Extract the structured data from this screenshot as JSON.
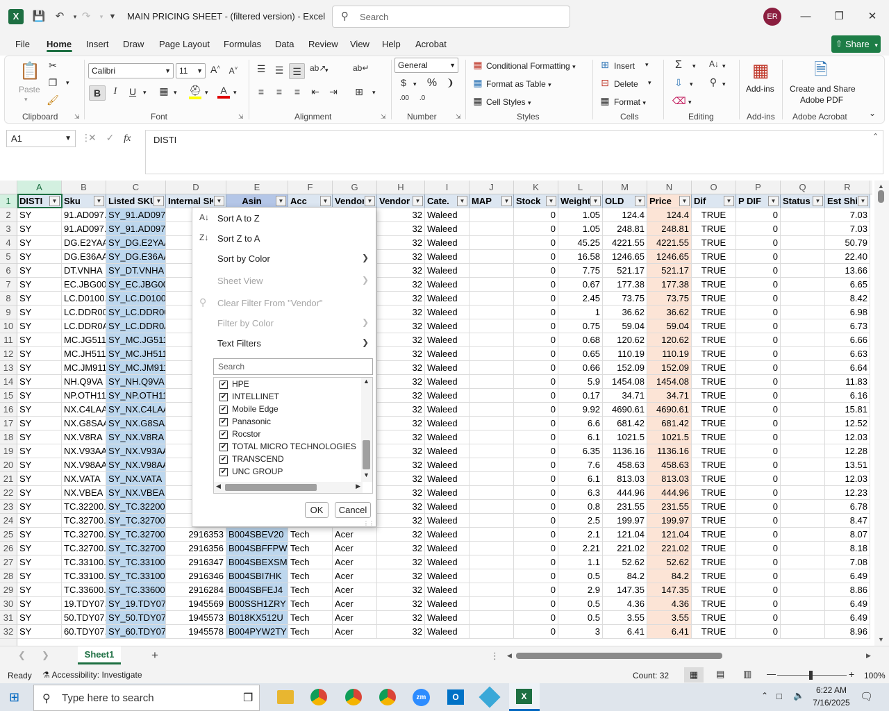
{
  "titlebar": {
    "title": "MAIN PRICING SHEET - (filtered version)  -  Excel",
    "search_placeholder": "Search",
    "user_initials": "ER"
  },
  "menu": [
    "File",
    "Home",
    "Insert",
    "Draw",
    "Page Layout",
    "Formulas",
    "Data",
    "Review",
    "View",
    "Help",
    "Acrobat"
  ],
  "share_label": "Share",
  "ribbon": {
    "paste": "Paste",
    "font_name": "Calibri",
    "font_size": "11",
    "number_format": "General",
    "conditional_formatting": "Conditional Formatting",
    "format_as_table": "Format as Table",
    "cell_styles": "Cell Styles",
    "insert": "Insert",
    "delete": "Delete",
    "format": "Format",
    "addins": "Add-ins",
    "create_share_line1": "Create and Share",
    "create_share_line2": "Adobe PDF",
    "groups": {
      "clipboard": "Clipboard",
      "font": "Font",
      "alignment": "Alignment",
      "number": "Number",
      "styles": "Styles",
      "cells": "Cells",
      "editing": "Editing",
      "addins": "Add-ins",
      "adobe": "Adobe Acrobat"
    }
  },
  "formula_bar": {
    "name_box": "A1",
    "content": "DISTI"
  },
  "columns": [
    "A",
    "B",
    "C",
    "D",
    "E",
    "F",
    "G",
    "H",
    "I",
    "J",
    "K",
    "L",
    "M",
    "N",
    "O",
    "P",
    "Q",
    "R"
  ],
  "headers": [
    "DISTI",
    "Sku",
    "Listed SKU",
    "Internal SK",
    "Asin",
    "Acc",
    "Vendor",
    "Vendor",
    "Cate.",
    "MAP",
    "Stock",
    "Weight",
    "OLD",
    "Price",
    "Dif",
    "P DIF",
    "Status",
    "Est Ship"
  ],
  "rows": [
    {
      "n": "2",
      "a": "SY",
      "b": "91.AD097.",
      "c": "SY_91.AD097.",
      "d": "",
      "e": "",
      "f": "",
      "g": "",
      "h": "32",
      "i": "Waleed",
      "j": "",
      "k": "0",
      "l": "1.05",
      "m": "124.4",
      "np": "124.4",
      "o": "TRUE",
      "p": "0",
      "q": "",
      "r": "7.03"
    },
    {
      "n": "3",
      "a": "SY",
      "b": "91.AD097.",
      "c": "SY_91.AD097.",
      "d": "",
      "e": "",
      "f": "",
      "g": "",
      "h": "32",
      "i": "Waleed",
      "j": "",
      "k": "0",
      "l": "1.05",
      "m": "248.81",
      "np": "248.81",
      "o": "TRUE",
      "p": "0",
      "q": "",
      "r": "7.03"
    },
    {
      "n": "4",
      "a": "SY",
      "b": "DG.E2YAA",
      "c": "SY_DG.E2YAA",
      "d": "",
      "e": "",
      "f": "",
      "g": "",
      "h": "32",
      "i": "Waleed",
      "j": "",
      "k": "0",
      "l": "45.25",
      "m": "4221.55",
      "np": "4221.55",
      "o": "TRUE",
      "p": "0",
      "q": "",
      "r": "50.79"
    },
    {
      "n": "5",
      "a": "SY",
      "b": "DG.E36AA",
      "c": "SY_DG.E36AA",
      "d": "",
      "e": "",
      "f": "",
      "g": "",
      "h": "32",
      "i": "Waleed",
      "j": "",
      "k": "0",
      "l": "16.58",
      "m": "1246.65",
      "np": "1246.65",
      "o": "TRUE",
      "p": "0",
      "q": "",
      "r": "22.40"
    },
    {
      "n": "6",
      "a": "SY",
      "b": "DT.VNHA",
      "c": "SY_DT.VNHA",
      "d": "",
      "e": "",
      "f": "",
      "g": "",
      "h": "32",
      "i": "Waleed",
      "j": "",
      "k": "0",
      "l": "7.75",
      "m": "521.17",
      "np": "521.17",
      "o": "TRUE",
      "p": "0",
      "q": "",
      "r": "13.66"
    },
    {
      "n": "7",
      "a": "SY",
      "b": "EC.JBG00.",
      "c": "SY_EC.JBG00.",
      "d": "",
      "e": "",
      "f": "",
      "g": "",
      "h": "32",
      "i": "Waleed",
      "j": "",
      "k": "0",
      "l": "0.67",
      "m": "177.38",
      "np": "177.38",
      "o": "TRUE",
      "p": "0",
      "q": "",
      "r": "6.65"
    },
    {
      "n": "8",
      "a": "SY",
      "b": "LC.D0100.",
      "c": "SY_LC.D0100.",
      "d": "",
      "e": "",
      "f": "",
      "g": "",
      "h": "32",
      "i": "Waleed",
      "j": "",
      "k": "0",
      "l": "2.45",
      "m": "73.75",
      "np": "73.75",
      "o": "TRUE",
      "p": "0",
      "q": "",
      "r": "8.42"
    },
    {
      "n": "9",
      "a": "SY",
      "b": "LC.DDR00.",
      "c": "SY_LC.DDR00.",
      "d": "",
      "e": "",
      "f": "",
      "g": "",
      "h": "32",
      "i": "Waleed",
      "j": "",
      "k": "0",
      "l": "1",
      "m": "36.62",
      "np": "36.62",
      "o": "TRUE",
      "p": "0",
      "q": "",
      "r": "6.98"
    },
    {
      "n": "10",
      "a": "SY",
      "b": "LC.DDR0A",
      "c": "SY_LC.DDR0A",
      "d": "",
      "e": "",
      "f": "",
      "g": "",
      "h": "32",
      "i": "Waleed",
      "j": "",
      "k": "0",
      "l": "0.75",
      "m": "59.04",
      "np": "59.04",
      "o": "TRUE",
      "p": "0",
      "q": "",
      "r": "6.73"
    },
    {
      "n": "11",
      "a": "SY",
      "b": "MC.JG511",
      "c": "SY_MC.JG511",
      "d": "",
      "e": "",
      "f": "",
      "g": "",
      "h": "32",
      "i": "Waleed",
      "j": "",
      "k": "0",
      "l": "0.68",
      "m": "120.62",
      "np": "120.62",
      "o": "TRUE",
      "p": "0",
      "q": "",
      "r": "6.66"
    },
    {
      "n": "12",
      "a": "SY",
      "b": "MC.JH511",
      "c": "SY_MC.JH511",
      "d": "",
      "e": "",
      "f": "",
      "g": "",
      "h": "32",
      "i": "Waleed",
      "j": "",
      "k": "0",
      "l": "0.65",
      "m": "110.19",
      "np": "110.19",
      "o": "TRUE",
      "p": "0",
      "q": "",
      "r": "6.63"
    },
    {
      "n": "13",
      "a": "SY",
      "b": "MC.JM911",
      "c": "SY_MC.JM911",
      "d": "",
      "e": "",
      "f": "",
      "g": "",
      "h": "32",
      "i": "Waleed",
      "j": "",
      "k": "0",
      "l": "0.66",
      "m": "152.09",
      "np": "152.09",
      "o": "TRUE",
      "p": "0",
      "q": "",
      "r": "6.64"
    },
    {
      "n": "14",
      "a": "SY",
      "b": "NH.Q9VA",
      "c": "SY_NH.Q9VA",
      "d": "",
      "e": "",
      "f": "",
      "g": "",
      "h": "32",
      "i": "Waleed",
      "j": "",
      "k": "0",
      "l": "5.9",
      "m": "1454.08",
      "np": "1454.08",
      "o": "TRUE",
      "p": "0",
      "q": "",
      "r": "11.83"
    },
    {
      "n": "15",
      "a": "SY",
      "b": "NP.OTH11",
      "c": "SY_NP.OTH11",
      "d": "",
      "e": "",
      "f": "",
      "g": "",
      "h": "32",
      "i": "Waleed",
      "j": "",
      "k": "0",
      "l": "0.17",
      "m": "34.71",
      "np": "34.71",
      "o": "TRUE",
      "p": "0",
      "q": "",
      "r": "6.16"
    },
    {
      "n": "16",
      "a": "SY",
      "b": "NX.C4LAA",
      "c": "SY_NX.C4LAA",
      "d": "",
      "e": "",
      "f": "",
      "g": "",
      "h": "32",
      "i": "Waleed",
      "j": "",
      "k": "0",
      "l": "9.92",
      "m": "4690.61",
      "np": "4690.61",
      "o": "TRUE",
      "p": "0",
      "q": "",
      "r": "15.81"
    },
    {
      "n": "17",
      "a": "SY",
      "b": "NX.G8SAA",
      "c": "SY_NX.G8SAA",
      "d": "",
      "e": "",
      "f": "",
      "g": "",
      "h": "32",
      "i": "Waleed",
      "j": "",
      "k": "0",
      "l": "6.6",
      "m": "681.42",
      "np": "681.42",
      "o": "TRUE",
      "p": "0",
      "q": "",
      "r": "12.52"
    },
    {
      "n": "18",
      "a": "SY",
      "b": "NX.V8RA",
      "c": "SY_NX.V8RA",
      "d": "",
      "e": "",
      "f": "",
      "g": "",
      "h": "32",
      "i": "Waleed",
      "j": "",
      "k": "0",
      "l": "6.1",
      "m": "1021.5",
      "np": "1021.5",
      "o": "TRUE",
      "p": "0",
      "q": "",
      "r": "12.03"
    },
    {
      "n": "19",
      "a": "SY",
      "b": "NX.V93AA",
      "c": "SY_NX.V93AA",
      "d": "",
      "e": "",
      "f": "",
      "g": "",
      "h": "32",
      "i": "Waleed",
      "j": "",
      "k": "0",
      "l": "6.35",
      "m": "1136.16",
      "np": "1136.16",
      "o": "TRUE",
      "p": "0",
      "q": "",
      "r": "12.28"
    },
    {
      "n": "20",
      "a": "SY",
      "b": "NX.V98AA",
      "c": "SY_NX.V98AA",
      "d": "",
      "e": "",
      "f": "",
      "g": "",
      "h": "32",
      "i": "Waleed",
      "j": "",
      "k": "0",
      "l": "7.6",
      "m": "458.63",
      "np": "458.63",
      "o": "TRUE",
      "p": "0",
      "q": "",
      "r": "13.51"
    },
    {
      "n": "21",
      "a": "SY",
      "b": "NX.VATA",
      "c": "SY_NX.VATA",
      "d": "",
      "e": "",
      "f": "",
      "g": "",
      "h": "32",
      "i": "Waleed",
      "j": "",
      "k": "0",
      "l": "6.1",
      "m": "813.03",
      "np": "813.03",
      "o": "TRUE",
      "p": "0",
      "q": "",
      "r": "12.03"
    },
    {
      "n": "22",
      "a": "SY",
      "b": "NX.VBEA",
      "c": "SY_NX.VBEA",
      "d": "",
      "e": "",
      "f": "",
      "g": "",
      "h": "32",
      "i": "Waleed",
      "j": "",
      "k": "0",
      "l": "6.3",
      "m": "444.96",
      "np": "444.96",
      "o": "TRUE",
      "p": "0",
      "q": "",
      "r": "12.23"
    },
    {
      "n": "23",
      "a": "SY",
      "b": "TC.32200.",
      "c": "SY_TC.32200.",
      "d": "",
      "e": "",
      "f": "",
      "g": "",
      "h": "32",
      "i": "Waleed",
      "j": "",
      "k": "0",
      "l": "0.8",
      "m": "231.55",
      "np": "231.55",
      "o": "TRUE",
      "p": "0",
      "q": "",
      "r": "6.78"
    },
    {
      "n": "24",
      "a": "SY",
      "b": "TC.32700.",
      "c": "SY_TC.32700.",
      "d": "",
      "e": "",
      "f": "",
      "g": "",
      "h": "32",
      "i": "Waleed",
      "j": "",
      "k": "0",
      "l": "2.5",
      "m": "199.97",
      "np": "199.97",
      "o": "TRUE",
      "p": "0",
      "q": "",
      "r": "8.47"
    },
    {
      "n": "25",
      "a": "SY",
      "b": "TC.32700.",
      "c": "SY_TC.32700.",
      "d": "2916353",
      "e": "B004SBEV20",
      "f": "Tech",
      "g": "Acer",
      "h": "32",
      "i": "Waleed",
      "j": "",
      "k": "0",
      "l": "2.1",
      "m": "121.04",
      "np": "121.04",
      "o": "TRUE",
      "p": "0",
      "q": "",
      "r": "8.07"
    },
    {
      "n": "26",
      "a": "SY",
      "b": "TC.32700.",
      "c": "SY_TC.32700.",
      "d": "2916356",
      "e": "B004SBFFPW",
      "f": "Tech",
      "g": "Acer",
      "h": "32",
      "i": "Waleed",
      "j": "",
      "k": "0",
      "l": "2.21",
      "m": "221.02",
      "np": "221.02",
      "o": "TRUE",
      "p": "0",
      "q": "",
      "r": "8.18"
    },
    {
      "n": "27",
      "a": "SY",
      "b": "TC.33100.",
      "c": "SY_TC.33100.",
      "d": "2916347",
      "e": "B004SBEXSM",
      "f": "Tech",
      "g": "Acer",
      "h": "32",
      "i": "Waleed",
      "j": "",
      "k": "0",
      "l": "1.1",
      "m": "52.62",
      "np": "52.62",
      "o": "TRUE",
      "p": "0",
      "q": "",
      "r": "7.08"
    },
    {
      "n": "28",
      "a": "SY",
      "b": "TC.33100.",
      "c": "SY_TC.33100.",
      "d": "2916346",
      "e": "B004SBI7HK",
      "f": "Tech",
      "g": "Acer",
      "h": "32",
      "i": "Waleed",
      "j": "",
      "k": "0",
      "l": "0.5",
      "m": "84.2",
      "np": "84.2",
      "o": "TRUE",
      "p": "0",
      "q": "",
      "r": "6.49"
    },
    {
      "n": "29",
      "a": "SY",
      "b": "TC.33600.",
      "c": "SY_TC.33600.",
      "d": "2916284",
      "e": "B004SBFEJ4",
      "f": "Tech",
      "g": "Acer",
      "h": "32",
      "i": "Waleed",
      "j": "",
      "k": "0",
      "l": "2.9",
      "m": "147.35",
      "np": "147.35",
      "o": "TRUE",
      "p": "0",
      "q": "",
      "r": "8.86"
    },
    {
      "n": "30",
      "a": "SY",
      "b": "19.TDY07.",
      "c": "SY_19.TDY07.",
      "d": "1945569",
      "e": "B00SSH1ZRY",
      "f": "Tech",
      "g": "Acer",
      "h": "32",
      "i": "Waleed",
      "j": "",
      "k": "0",
      "l": "0.5",
      "m": "4.36",
      "np": "4.36",
      "o": "TRUE",
      "p": "0",
      "q": "",
      "r": "6.49"
    },
    {
      "n": "31",
      "a": "SY",
      "b": "50.TDY07.",
      "c": "SY_50.TDY07.",
      "d": "1945573",
      "e": "B018KX512U",
      "f": "Tech",
      "g": "Acer",
      "h": "32",
      "i": "Waleed",
      "j": "",
      "k": "0",
      "l": "0.5",
      "m": "3.55",
      "np": "3.55",
      "o": "TRUE",
      "p": "0",
      "q": "",
      "r": "6.49"
    },
    {
      "n": "32",
      "a": "SY",
      "b": "60.TDY07.",
      "c": "SY_60.TDY07.",
      "d": "1945578",
      "e": "B004PYW2TY",
      "f": "Tech",
      "g": "Acer",
      "h": "32",
      "i": "Waleed",
      "j": "",
      "k": "0",
      "l": "3",
      "m": "6.41",
      "np": "6.41",
      "o": "TRUE",
      "p": "0",
      "q": "",
      "r": "8.96"
    }
  ],
  "filter_menu": {
    "sort_az": "Sort A to Z",
    "sort_za": "Sort Z to A",
    "sort_color": "Sort by Color",
    "sheet_view": "Sheet View",
    "clear_filter": "Clear Filter From \"Vendor\"",
    "filter_color": "Filter by Color",
    "text_filters": "Text Filters",
    "search_placeholder": "Search",
    "items": [
      "HPE",
      "INTELLINET",
      "Mobile Edge",
      "Panasonic",
      "Rocstor",
      "TOTAL MICRO TECHNOLOGIES",
      "TRANSCEND",
      "UNC GROUP"
    ],
    "ok": "OK",
    "cancel": "Cancel"
  },
  "sheet_tab": "Sheet1",
  "status": {
    "ready": "Ready",
    "accessibility": "Accessibility: Investigate",
    "count": "Count: 32",
    "zoom": "100%"
  },
  "taskbar": {
    "search_placeholder": "Type here to search",
    "time": "6:22 AM",
    "date": "7/16/2025"
  }
}
